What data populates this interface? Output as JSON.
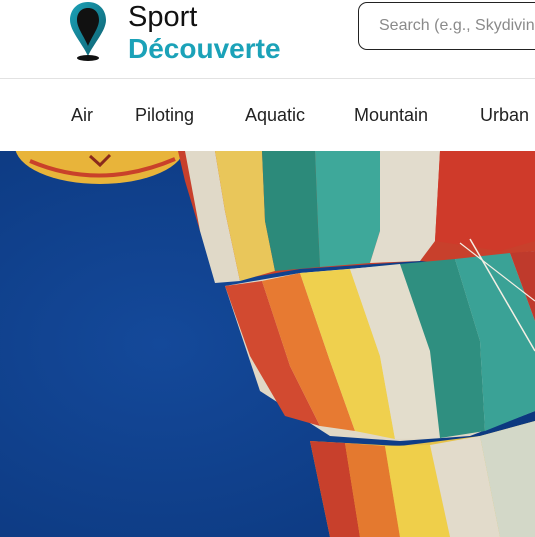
{
  "brand": {
    "name_line1": "Sport",
    "name_line2": "Découverte",
    "accent_color": "#1ba2b8"
  },
  "search": {
    "placeholder": "Search (e.g., Skydiving)",
    "value": ""
  },
  "nav": {
    "items": [
      {
        "label": "Air"
      },
      {
        "label": "Piloting"
      },
      {
        "label": "Aquatic"
      },
      {
        "label": "Mountain"
      },
      {
        "label": "Urban"
      }
    ]
  },
  "hero": {
    "subject": "hot-air balloons against blue sky",
    "sky_color": "#0d3b86"
  }
}
